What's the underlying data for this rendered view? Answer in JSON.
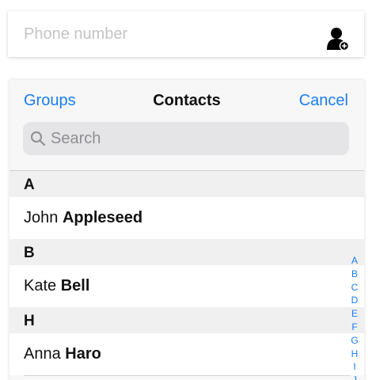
{
  "phone_field": {
    "placeholder": "Phone number",
    "value": "",
    "icon": "add-contact-icon"
  },
  "picker": {
    "left_button": "Groups",
    "title": "Contacts",
    "right_button": "Cancel",
    "search": {
      "placeholder": "Search",
      "value": "",
      "icon": "search-icon"
    },
    "sections": [
      {
        "letter": "A",
        "contacts": [
          {
            "first": "John",
            "last": "Appleseed"
          }
        ]
      },
      {
        "letter": "B",
        "contacts": [
          {
            "first": "Kate",
            "last": "Bell"
          }
        ]
      },
      {
        "letter": "H",
        "contacts": [
          {
            "first": "Anna",
            "last": "Haro"
          }
        ]
      }
    ],
    "index_letters": [
      "A",
      "B",
      "C",
      "D",
      "E",
      "F",
      "G",
      "H",
      "I",
      "J"
    ]
  },
  "colors": {
    "accent": "#1a7df0",
    "section_bg": "#f0f0f0",
    "search_bg": "#e5e5e8",
    "placeholder": "#c4c4c4"
  }
}
